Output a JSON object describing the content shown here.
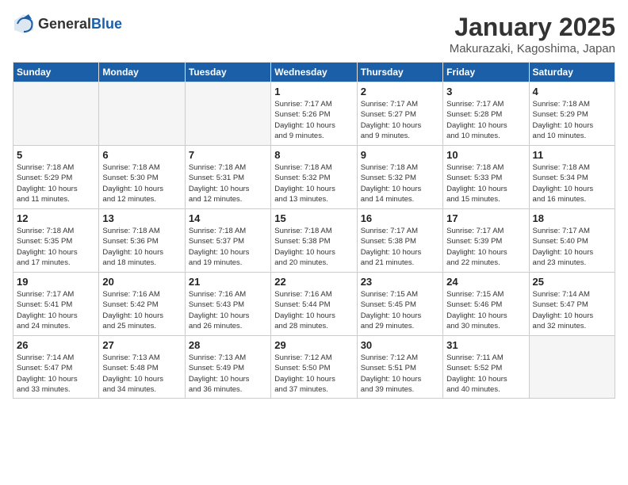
{
  "header": {
    "logo_general": "General",
    "logo_blue": "Blue",
    "title": "January 2025",
    "subtitle": "Makurazaki, Kagoshima, Japan"
  },
  "weekdays": [
    "Sunday",
    "Monday",
    "Tuesday",
    "Wednesday",
    "Thursday",
    "Friday",
    "Saturday"
  ],
  "weeks": [
    [
      {
        "day": "",
        "info": ""
      },
      {
        "day": "",
        "info": ""
      },
      {
        "day": "",
        "info": ""
      },
      {
        "day": "1",
        "info": "Sunrise: 7:17 AM\nSunset: 5:26 PM\nDaylight: 10 hours\nand 9 minutes."
      },
      {
        "day": "2",
        "info": "Sunrise: 7:17 AM\nSunset: 5:27 PM\nDaylight: 10 hours\nand 9 minutes."
      },
      {
        "day": "3",
        "info": "Sunrise: 7:17 AM\nSunset: 5:28 PM\nDaylight: 10 hours\nand 10 minutes."
      },
      {
        "day": "4",
        "info": "Sunrise: 7:18 AM\nSunset: 5:29 PM\nDaylight: 10 hours\nand 10 minutes."
      }
    ],
    [
      {
        "day": "5",
        "info": "Sunrise: 7:18 AM\nSunset: 5:29 PM\nDaylight: 10 hours\nand 11 minutes."
      },
      {
        "day": "6",
        "info": "Sunrise: 7:18 AM\nSunset: 5:30 PM\nDaylight: 10 hours\nand 12 minutes."
      },
      {
        "day": "7",
        "info": "Sunrise: 7:18 AM\nSunset: 5:31 PM\nDaylight: 10 hours\nand 12 minutes."
      },
      {
        "day": "8",
        "info": "Sunrise: 7:18 AM\nSunset: 5:32 PM\nDaylight: 10 hours\nand 13 minutes."
      },
      {
        "day": "9",
        "info": "Sunrise: 7:18 AM\nSunset: 5:32 PM\nDaylight: 10 hours\nand 14 minutes."
      },
      {
        "day": "10",
        "info": "Sunrise: 7:18 AM\nSunset: 5:33 PM\nDaylight: 10 hours\nand 15 minutes."
      },
      {
        "day": "11",
        "info": "Sunrise: 7:18 AM\nSunset: 5:34 PM\nDaylight: 10 hours\nand 16 minutes."
      }
    ],
    [
      {
        "day": "12",
        "info": "Sunrise: 7:18 AM\nSunset: 5:35 PM\nDaylight: 10 hours\nand 17 minutes."
      },
      {
        "day": "13",
        "info": "Sunrise: 7:18 AM\nSunset: 5:36 PM\nDaylight: 10 hours\nand 18 minutes."
      },
      {
        "day": "14",
        "info": "Sunrise: 7:18 AM\nSunset: 5:37 PM\nDaylight: 10 hours\nand 19 minutes."
      },
      {
        "day": "15",
        "info": "Sunrise: 7:18 AM\nSunset: 5:38 PM\nDaylight: 10 hours\nand 20 minutes."
      },
      {
        "day": "16",
        "info": "Sunrise: 7:17 AM\nSunset: 5:38 PM\nDaylight: 10 hours\nand 21 minutes."
      },
      {
        "day": "17",
        "info": "Sunrise: 7:17 AM\nSunset: 5:39 PM\nDaylight: 10 hours\nand 22 minutes."
      },
      {
        "day": "18",
        "info": "Sunrise: 7:17 AM\nSunset: 5:40 PM\nDaylight: 10 hours\nand 23 minutes."
      }
    ],
    [
      {
        "day": "19",
        "info": "Sunrise: 7:17 AM\nSunset: 5:41 PM\nDaylight: 10 hours\nand 24 minutes."
      },
      {
        "day": "20",
        "info": "Sunrise: 7:16 AM\nSunset: 5:42 PM\nDaylight: 10 hours\nand 25 minutes."
      },
      {
        "day": "21",
        "info": "Sunrise: 7:16 AM\nSunset: 5:43 PM\nDaylight: 10 hours\nand 26 minutes."
      },
      {
        "day": "22",
        "info": "Sunrise: 7:16 AM\nSunset: 5:44 PM\nDaylight: 10 hours\nand 28 minutes."
      },
      {
        "day": "23",
        "info": "Sunrise: 7:15 AM\nSunset: 5:45 PM\nDaylight: 10 hours\nand 29 minutes."
      },
      {
        "day": "24",
        "info": "Sunrise: 7:15 AM\nSunset: 5:46 PM\nDaylight: 10 hours\nand 30 minutes."
      },
      {
        "day": "25",
        "info": "Sunrise: 7:14 AM\nSunset: 5:47 PM\nDaylight: 10 hours\nand 32 minutes."
      }
    ],
    [
      {
        "day": "26",
        "info": "Sunrise: 7:14 AM\nSunset: 5:47 PM\nDaylight: 10 hours\nand 33 minutes."
      },
      {
        "day": "27",
        "info": "Sunrise: 7:13 AM\nSunset: 5:48 PM\nDaylight: 10 hours\nand 34 minutes."
      },
      {
        "day": "28",
        "info": "Sunrise: 7:13 AM\nSunset: 5:49 PM\nDaylight: 10 hours\nand 36 minutes."
      },
      {
        "day": "29",
        "info": "Sunrise: 7:12 AM\nSunset: 5:50 PM\nDaylight: 10 hours\nand 37 minutes."
      },
      {
        "day": "30",
        "info": "Sunrise: 7:12 AM\nSunset: 5:51 PM\nDaylight: 10 hours\nand 39 minutes."
      },
      {
        "day": "31",
        "info": "Sunrise: 7:11 AM\nSunset: 5:52 PM\nDaylight: 10 hours\nand 40 minutes."
      },
      {
        "day": "",
        "info": ""
      }
    ]
  ]
}
